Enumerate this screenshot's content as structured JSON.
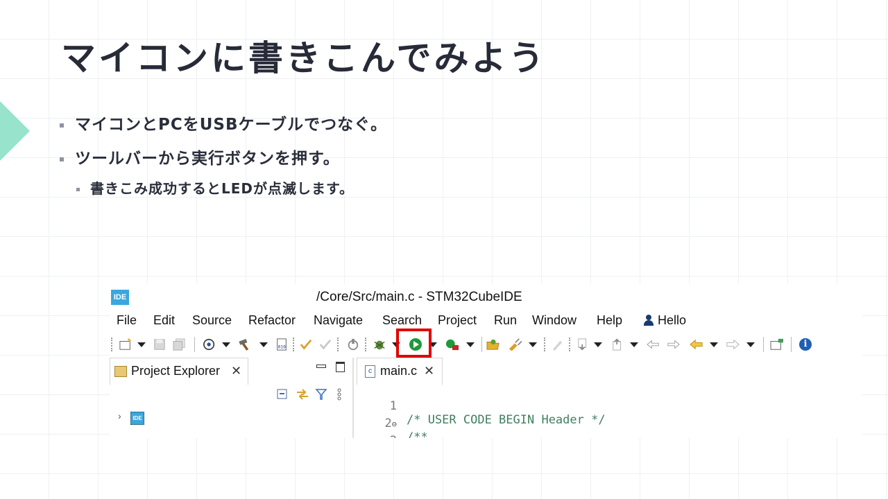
{
  "slide": {
    "title": "マイコンに書きこんでみよう",
    "bullets": [
      "マイコンとPCをUSBケーブルでつなぐ。",
      "ツールバーから実行ボタンを押す。"
    ],
    "sub_bullet": "書きこみ成功するとLEDが点滅します。"
  },
  "ide": {
    "logo_text": "IDE",
    "window_title": "/Core/Src/main.c - STM32CubeIDE",
    "menu": [
      "File",
      "Edit",
      "Source",
      "Refactor",
      "Navigate",
      "Search",
      "Project",
      "Run",
      "Window",
      "Help",
      "Hello"
    ],
    "toolbar": {
      "run_button": "play-circle-icon",
      "highlight_color": "#e00000",
      "info_glyph": "i"
    },
    "project_explorer": {
      "tab_label": "Project Explorer",
      "close_glyph": "✕",
      "tree_chevron": "›",
      "project_icon_text": "IDE"
    },
    "editor": {
      "tab_label": "main.c",
      "tab_icon_text": "c",
      "close_glyph": "✕",
      "lines": [
        {
          "num": "1",
          "fold": "",
          "text": "/* USER CODE BEGIN Header */"
        },
        {
          "num": "2",
          "fold": "⊖",
          "text": "/**"
        },
        {
          "num": "3",
          "fold": "",
          "text": "  ******************************************************"
        }
      ]
    }
  },
  "colors": {
    "accent_triangle": "#97e3cc",
    "comment_green": "#3f7f5f",
    "run_green": "#1e9a3c",
    "ide_blue": "#3aa7de"
  }
}
